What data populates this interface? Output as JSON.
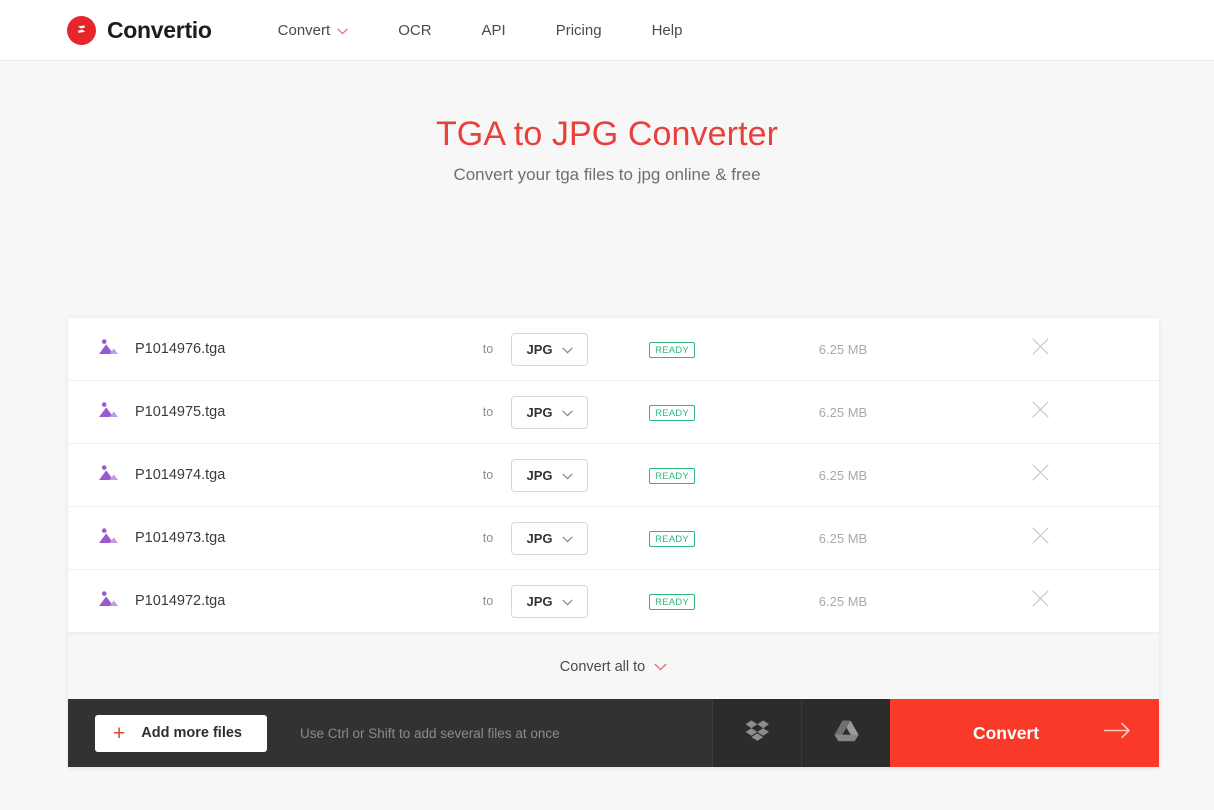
{
  "header": {
    "brand": {
      "name": "Convertio",
      "logo_icon": "convertio-logo-icon",
      "logo_color": "#e8252a"
    },
    "nav": [
      {
        "label": "Convert",
        "has_dropdown": true,
        "icon": "chevron-down-icon"
      },
      {
        "label": "OCR",
        "has_dropdown": false
      },
      {
        "label": "API",
        "has_dropdown": false
      },
      {
        "label": "Pricing",
        "has_dropdown": false
      },
      {
        "label": "Help",
        "has_dropdown": false
      }
    ]
  },
  "hero": {
    "title": "TGA to JPG Converter",
    "subtitle": "Convert your tga files to jpg online & free",
    "title_color": "#e8413c"
  },
  "files": {
    "to_label": "to",
    "rows": [
      {
        "icon": "image-file-icon",
        "name": "P1014976.tga",
        "format": "JPG",
        "status": "READY",
        "size": "6.25 MB"
      },
      {
        "icon": "image-file-icon",
        "name": "P1014975.tga",
        "format": "JPG",
        "status": "READY",
        "size": "6.25 MB"
      },
      {
        "icon": "image-file-icon",
        "name": "P1014974.tga",
        "format": "JPG",
        "status": "READY",
        "size": "6.25 MB"
      },
      {
        "icon": "image-file-icon",
        "name": "P1014973.tga",
        "format": "JPG",
        "status": "READY",
        "size": "6.25 MB"
      },
      {
        "icon": "image-file-icon",
        "name": "P1014972.tga",
        "format": "JPG",
        "status": "READY",
        "size": "6.25 MB"
      }
    ],
    "status_color": "#2db87a",
    "remove_icon": "close-icon"
  },
  "convert_all": {
    "label": "Convert all to",
    "icon": "chevron-down-icon"
  },
  "action_bar": {
    "add_label": "Add more files",
    "add_icon": "plus-icon",
    "hint": "Use Ctrl or Shift to add several files at once",
    "dropbox_icon": "dropbox-icon",
    "gdrive_icon": "google-drive-icon",
    "convert_label": "Convert",
    "convert_arrow_icon": "arrow-right-icon",
    "convert_color": "#f93a28"
  }
}
